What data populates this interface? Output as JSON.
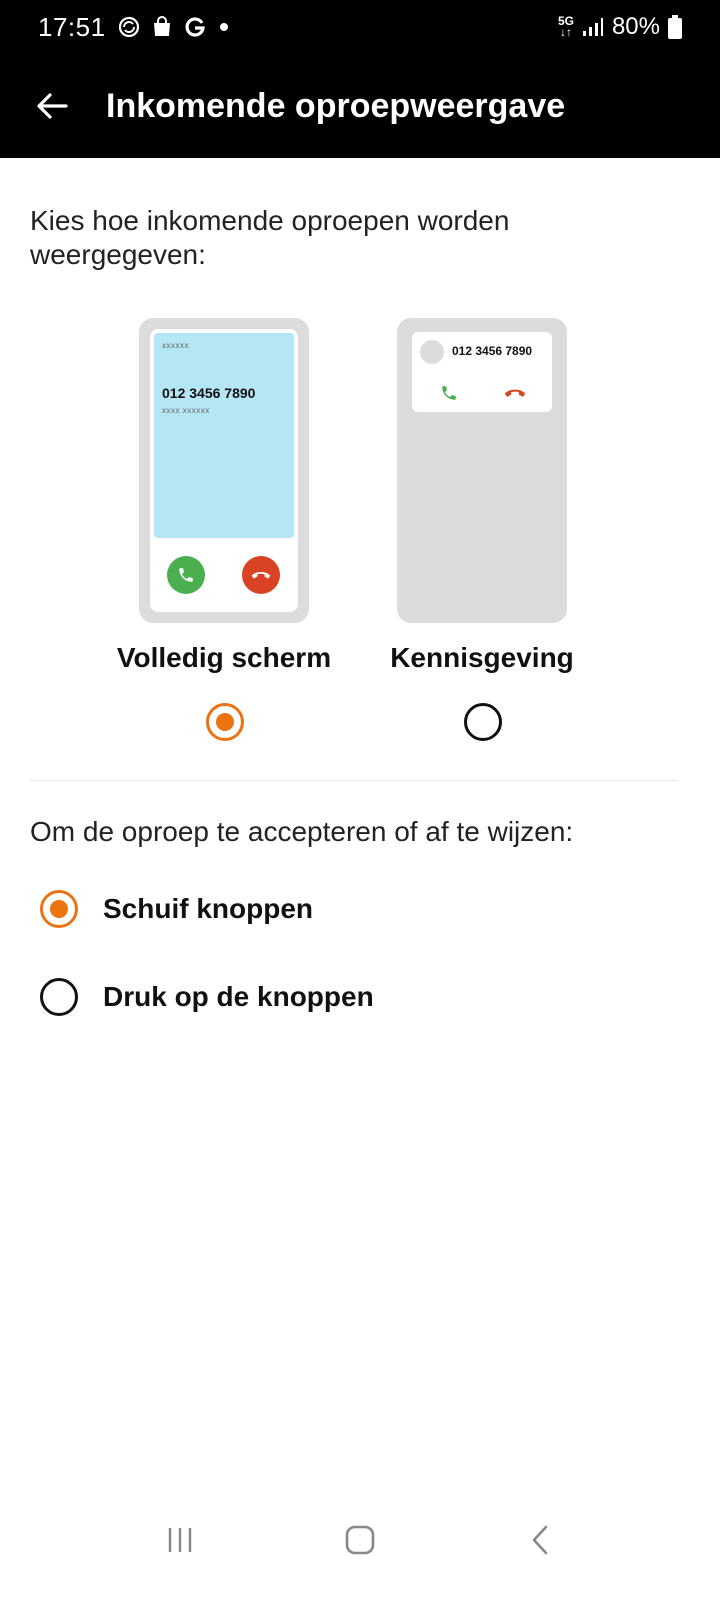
{
  "status_bar": {
    "time": "17:51",
    "network": "5G",
    "battery": "80%"
  },
  "app_bar": {
    "title": "Inkomende oproepweergave"
  },
  "display_section": {
    "prompt": "Kies hoe inkomende oproepen worden weergegeven:",
    "options": [
      {
        "label": "Volledig scherm",
        "selected": true,
        "preview_caption_top": "xxxxxx",
        "preview_number": "012 3456 7890",
        "preview_caption_sub": "xxxx xxxxxx"
      },
      {
        "label": "Kennisgeving",
        "selected": false,
        "preview_number": "012 3456 7890"
      }
    ]
  },
  "answer_section": {
    "prompt": "Om de oproep te accepteren of af te wijzen:",
    "options": [
      {
        "label": "Schuif knoppen",
        "selected": true
      },
      {
        "label": "Druk op de knoppen",
        "selected": false
      }
    ]
  },
  "colors": {
    "accent": "#ec7311",
    "accept_green": "#4bae4f",
    "decline_red": "#d84423",
    "preview_blue": "#b5e6f4"
  }
}
